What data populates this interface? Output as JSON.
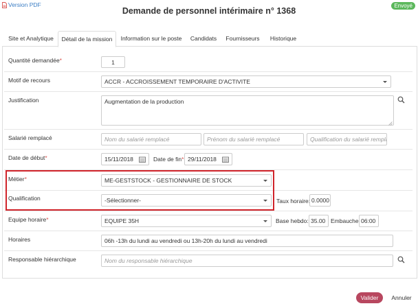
{
  "header": {
    "pdf_label": "Version PDF",
    "title": "Demande de personnel intérimaire n° 1368",
    "status": "Envoyé"
  },
  "tabs": [
    {
      "label": "Site et Analytique",
      "active": false
    },
    {
      "label": "Détail de la mission",
      "active": true
    },
    {
      "label": "Information sur le poste",
      "active": false
    },
    {
      "label": "Candidats",
      "active": false
    },
    {
      "label": "Fournisseurs",
      "active": false
    },
    {
      "label": "Historique",
      "active": false
    }
  ],
  "form": {
    "quantite": {
      "label": "Quantité demandée",
      "required": "*",
      "value": "1"
    },
    "motif": {
      "label": "Motif de recours",
      "value": "ACCR - ACCROISSEMENT TEMPORAIRE D'ACTIVITE"
    },
    "justification": {
      "label": "Justification",
      "value": "Augmentation de la production"
    },
    "salarie": {
      "label": "Salarié remplacé",
      "nom_placeholder": "Nom du salarié remplacé",
      "prenom_placeholder": "Prénom du salarié remplacé",
      "qualif_placeholder": "Qualification du salarié remplac"
    },
    "dates": {
      "debut_label": "Date de début",
      "debut_value": "15/11/2018",
      "fin_label": "Date de fin",
      "fin_value": "29/11/2018",
      "required": "*"
    },
    "metier": {
      "label": "Métier",
      "required": "*",
      "value": "ME-GESTSTOCK - GESTIONNAIRE DE STOCK"
    },
    "qualification": {
      "label": "Qualification",
      "value": "-Sélectionner-"
    },
    "taux": {
      "label": "Taux horaire:",
      "value": "0.0000"
    },
    "equipe": {
      "label": "Equipe horaire",
      "required": "*",
      "value": "EQUIPE 35H"
    },
    "base": {
      "label": "Base hebdo:",
      "value": "35.00"
    },
    "embauche": {
      "label": "Embauche:",
      "value": "06:00"
    },
    "horaires": {
      "label": "Horaires",
      "value": "06h -13h du lundi au vendredi ou 13h-20h du lundi au vendredi"
    },
    "responsable": {
      "label": "Responsable hiérarchique",
      "placeholder": "Nom du responsable hiérarchique"
    }
  },
  "footer": {
    "valider": "Valider",
    "annuler": "Annuler"
  },
  "colors": {
    "accent": "#b8475f",
    "status": "#5cb85c",
    "link": "#3a7dc4",
    "highlight": "#d0232a"
  }
}
